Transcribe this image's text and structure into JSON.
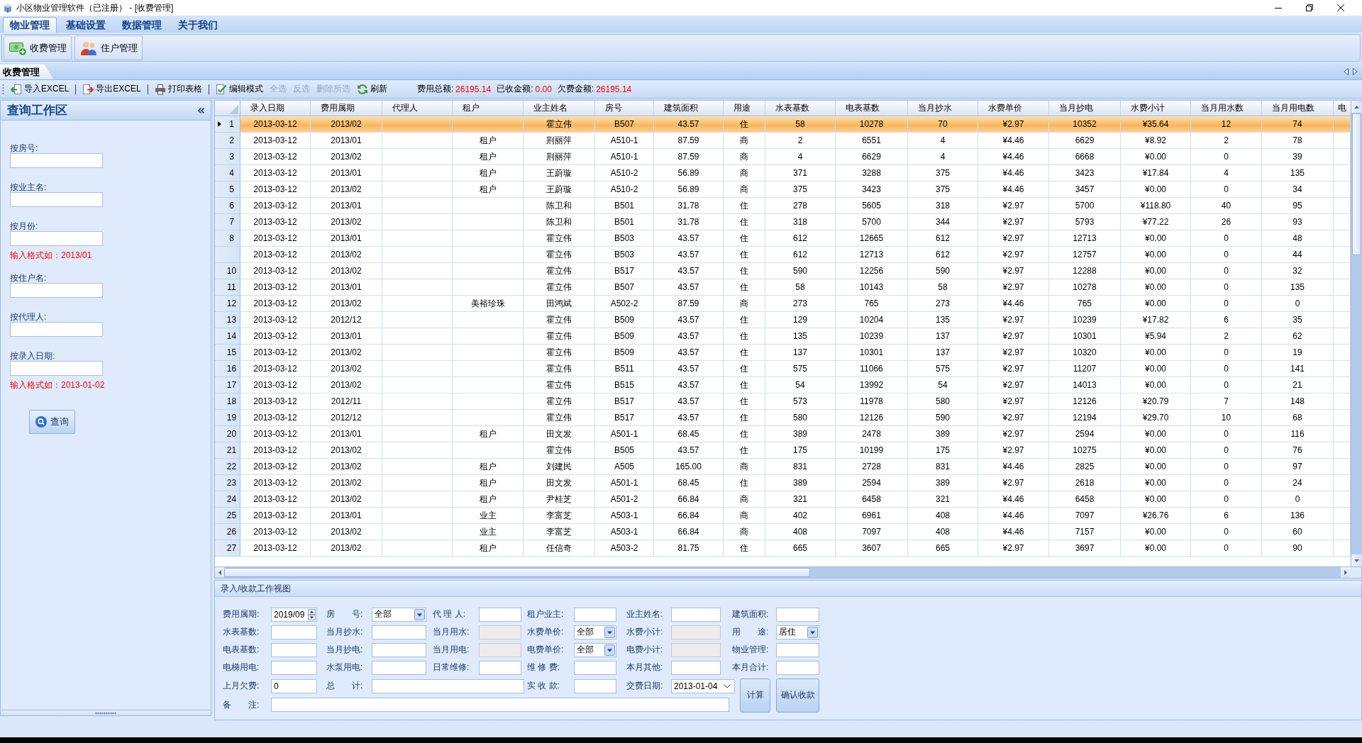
{
  "window": {
    "title": "小区物业管理软件（已注册） - [收费管理]"
  },
  "menu_tabs": [
    {
      "label": "物业管理",
      "selected": true
    },
    {
      "label": "基础设置",
      "selected": false
    },
    {
      "label": "数据管理",
      "selected": false
    },
    {
      "label": "关于我们",
      "selected": false
    }
  ],
  "ribbon": {
    "buttons": [
      "收费管理",
      "住户管理"
    ]
  },
  "document_tabs": [
    {
      "label": "收费管理",
      "selected": true
    }
  ],
  "toolbar": {
    "items": [
      {
        "kind": "button",
        "label": "导入EXCEL",
        "disabled": false
      },
      {
        "kind": "separator"
      },
      {
        "kind": "button",
        "label": "导出EXCEL",
        "disabled": false
      },
      {
        "kind": "separator"
      },
      {
        "kind": "button",
        "label": "打印表格",
        "disabled": false
      },
      {
        "kind": "separator"
      },
      {
        "kind": "button",
        "label": "编辑模式",
        "disabled": false
      },
      {
        "kind": "button",
        "label": "全选",
        "disabled": true
      },
      {
        "kind": "button",
        "label": "反选",
        "disabled": true
      },
      {
        "kind": "button",
        "label": "删除所选",
        "disabled": true
      },
      {
        "kind": "button",
        "label": "刷新",
        "disabled": false
      }
    ],
    "totals": [
      {
        "label": "费用总额:",
        "value": "26195.14"
      },
      {
        "label": "已收金额:",
        "value": "0.00"
      },
      {
        "label": "欠费金额:",
        "value": "26195.14"
      }
    ]
  },
  "search_panel": {
    "title": "查询工作区",
    "fields": [
      {
        "label": "按房号:"
      },
      {
        "label": "按业主名:"
      },
      {
        "label": "按月份:",
        "hint": "输入格式如：2013/01"
      },
      {
        "label": "按住户名:"
      },
      {
        "label": "按代理人:"
      },
      {
        "label": "按录入日期:",
        "hint": "输入格式如：2013-01-02"
      }
    ],
    "button": "查询"
  },
  "grid": {
    "columns": [
      "录入日期",
      "费用属期",
      "代理人",
      "租户",
      "业主姓名",
      "房号",
      "建筑面积",
      "用途",
      "水表基数",
      "电表基数",
      "当月抄水",
      "水费单价",
      "当月抄电",
      "水费小计",
      "当月用水数",
      "当月用电数",
      "电"
    ],
    "rows": [
      {
        "number": "1",
        "selected": true,
        "date": "2013-03-12",
        "period": "2013/02",
        "owner": "霍立伟",
        "room": "B507",
        "area": "43.57",
        "use": "住",
        "water_base": "58",
        "power_base": "10278",
        "water_now": "70",
        "water_price": "¥2.97",
        "power_now": "10352",
        "water_fee": "¥35.64",
        "water_used": "12",
        "power_used": "74"
      },
      {
        "number": "2",
        "selected": false,
        "date": "2013-03-12",
        "period": "2013/01",
        "tenant": "租户",
        "owner": "荆丽萍",
        "room": "A510-1",
        "area": "87.59",
        "use": "商",
        "water_base": "2",
        "power_base": "6551",
        "water_now": "4",
        "water_price": "¥4.46",
        "power_now": "6629",
        "water_fee": "¥8.92",
        "water_used": "2",
        "power_used": "78"
      },
      {
        "number": "3",
        "selected": false,
        "date": "2013-03-12",
        "period": "2013/02",
        "tenant": "租户",
        "owner": "荆丽萍",
        "room": "A510-1",
        "area": "87.59",
        "use": "商",
        "water_base": "4",
        "power_base": "6629",
        "water_now": "4",
        "water_price": "¥4.46",
        "power_now": "6668",
        "water_fee": "¥0.00",
        "water_used": "0",
        "power_used": "39"
      },
      {
        "number": "4",
        "selected": false,
        "date": "2013-03-12",
        "period": "2013/01",
        "tenant": "租户",
        "owner": "王蔚璇",
        "room": "A510-2",
        "area": "56.89",
        "use": "商",
        "water_base": "371",
        "power_base": "3288",
        "water_now": "375",
        "water_price": "¥4.46",
        "power_now": "3423",
        "water_fee": "¥17.84",
        "water_used": "4",
        "power_used": "135"
      },
      {
        "number": "5",
        "selected": false,
        "date": "2013-03-12",
        "period": "2013/02",
        "tenant": "租户",
        "owner": "王蔚璇",
        "room": "A510-2",
        "area": "56.89",
        "use": "商",
        "water_base": "375",
        "power_base": "3423",
        "water_now": "375",
        "water_price": "¥4.46",
        "power_now": "3457",
        "water_fee": "¥0.00",
        "water_used": "0",
        "power_used": "34"
      },
      {
        "number": "6",
        "selected": false,
        "date": "2013-03-12",
        "period": "2013/01",
        "owner": "陈卫和",
        "room": "B501",
        "area": "31.78",
        "use": "住",
        "water_base": "278",
        "power_base": "5605",
        "water_now": "318",
        "water_price": "¥2.97",
        "power_now": "5700",
        "water_fee": "¥118.80",
        "water_used": "40",
        "power_used": "95"
      },
      {
        "number": "7",
        "selected": false,
        "date": "2013-03-12",
        "period": "2013/02",
        "owner": "陈卫和",
        "room": "B501",
        "area": "31.78",
        "use": "住",
        "water_base": "318",
        "power_base": "5700",
        "water_now": "344",
        "water_price": "¥2.97",
        "power_now": "5793",
        "water_fee": "¥77.22",
        "water_used": "26",
        "power_used": "93"
      },
      {
        "number": "8",
        "selected": false,
        "date": "2013-03-12",
        "period": "2013/01",
        "owner": "霍立伟",
        "room": "B503",
        "area": "43.57",
        "use": "住",
        "water_base": "612",
        "power_base": "12665",
        "water_now": "612",
        "water_price": "¥2.97",
        "power_now": "12713",
        "water_fee": "¥0.00",
        "water_used": "0",
        "power_used": "48"
      },
      {
        "selected": false,
        "date": "2013-03-12",
        "period": "2013/02",
        "owner": "霍立伟",
        "room": "B503",
        "area": "43.57",
        "use": "住",
        "water_base": "612",
        "power_base": "12713",
        "water_now": "612",
        "water_price": "¥2.97",
        "power_now": "12757",
        "water_fee": "¥0.00",
        "water_used": "0",
        "power_used": "44"
      },
      {
        "number": "10",
        "selected": false,
        "date": "2013-03-12",
        "period": "2013/02",
        "owner": "霍立伟",
        "room": "B517",
        "area": "43.57",
        "use": "住",
        "water_base": "590",
        "power_base": "12256",
        "water_now": "590",
        "water_price": "¥2.97",
        "power_now": "12288",
        "water_fee": "¥0.00",
        "water_used": "0",
        "power_used": "32"
      },
      {
        "number": "11",
        "selected": false,
        "date": "2013-03-12",
        "period": "2013/01",
        "owner": "霍立伟",
        "room": "B507",
        "area": "43.57",
        "use": "住",
        "water_base": "58",
        "power_base": "10143",
        "water_now": "58",
        "water_price": "¥2.97",
        "power_now": "10278",
        "water_fee": "¥0.00",
        "water_used": "0",
        "power_used": "135"
      },
      {
        "number": "12",
        "selected": false,
        "date": "2013-03-12",
        "period": "2013/02",
        "tenant": "美裕珍珠",
        "owner": "田鸿斌",
        "room": "A502-2",
        "area": "87.59",
        "use": "商",
        "water_base": "273",
        "power_base": "765",
        "water_now": "273",
        "water_price": "¥4.46",
        "power_now": "765",
        "water_fee": "¥0.00",
        "water_used": "0",
        "power_used": "0"
      },
      {
        "number": "13",
        "selected": false,
        "date": "2013-03-12",
        "period": "2012/12",
        "owner": "霍立伟",
        "room": "B509",
        "area": "43.57",
        "use": "住",
        "water_base": "129",
        "power_base": "10204",
        "water_now": "135",
        "water_price": "¥2.97",
        "power_now": "10239",
        "water_fee": "¥17.82",
        "water_used": "6",
        "power_used": "35"
      },
      {
        "number": "14",
        "selected": false,
        "date": "2013-03-12",
        "period": "2013/01",
        "owner": "霍立伟",
        "room": "B509",
        "area": "43.57",
        "use": "住",
        "water_base": "135",
        "power_base": "10239",
        "water_now": "137",
        "water_price": "¥2.97",
        "power_now": "10301",
        "water_fee": "¥5.94",
        "water_used": "2",
        "power_used": "62"
      },
      {
        "number": "15",
        "selected": false,
        "date": "2013-03-12",
        "period": "2013/02",
        "owner": "霍立伟",
        "room": "B509",
        "area": "43.57",
        "use": "住",
        "water_base": "137",
        "power_base": "10301",
        "water_now": "137",
        "water_price": "¥2.97",
        "power_now": "10320",
        "water_fee": "¥0.00",
        "water_used": "0",
        "power_used": "19"
      },
      {
        "number": "16",
        "selected": false,
        "date": "2013-03-12",
        "period": "2013/02",
        "owner": "霍立伟",
        "room": "B511",
        "area": "43.57",
        "use": "住",
        "water_base": "575",
        "power_base": "11066",
        "water_now": "575",
        "water_price": "¥2.97",
        "power_now": "11207",
        "water_fee": "¥0.00",
        "water_used": "0",
        "power_used": "141"
      },
      {
        "number": "17",
        "selected": false,
        "date": "2013-03-12",
        "period": "2013/02",
        "owner": "霍立伟",
        "room": "B515",
        "area": "43.57",
        "use": "住",
        "water_base": "54",
        "power_base": "13992",
        "water_now": "54",
        "water_price": "¥2.97",
        "power_now": "14013",
        "water_fee": "¥0.00",
        "water_used": "0",
        "power_used": "21"
      },
      {
        "number": "18",
        "selected": false,
        "date": "2013-03-12",
        "period": "2012/11",
        "owner": "霍立伟",
        "room": "B517",
        "area": "43.57",
        "use": "住",
        "water_base": "573",
        "power_base": "11978",
        "water_now": "580",
        "water_price": "¥2.97",
        "power_now": "12126",
        "water_fee": "¥20.79",
        "water_used": "7",
        "power_used": "148"
      },
      {
        "number": "19",
        "selected": false,
        "date": "2013-03-12",
        "period": "2012/12",
        "owner": "霍立伟",
        "room": "B517",
        "area": "43.57",
        "use": "住",
        "water_base": "580",
        "power_base": "12126",
        "water_now": "590",
        "water_price": "¥2.97",
        "power_now": "12194",
        "water_fee": "¥29.70",
        "water_used": "10",
        "power_used": "68"
      },
      {
        "number": "20",
        "selected": false,
        "date": "2013-03-12",
        "period": "2013/01",
        "tenant": "租户",
        "owner": "田文发",
        "room": "A501-1",
        "area": "68.45",
        "use": "住",
        "water_base": "389",
        "power_base": "2478",
        "water_now": "389",
        "water_price": "¥2.97",
        "power_now": "2594",
        "water_fee": "¥0.00",
        "water_used": "0",
        "power_used": "116"
      },
      {
        "number": "21",
        "selected": false,
        "date": "2013-03-12",
        "period": "2013/02",
        "owner": "霍立伟",
        "room": "B505",
        "area": "43.57",
        "use": "住",
        "water_base": "175",
        "power_base": "10199",
        "water_now": "175",
        "water_price": "¥2.97",
        "power_now": "10275",
        "water_fee": "¥0.00",
        "water_used": "0",
        "power_used": "76"
      },
      {
        "number": "22",
        "selected": false,
        "date": "2013-03-12",
        "period": "2013/02",
        "tenant": "租户",
        "owner": "刘建民",
        "room": "A505",
        "area": "165.00",
        "use": "商",
        "water_base": "831",
        "power_base": "2728",
        "water_now": "831",
        "water_price": "¥4.46",
        "power_now": "2825",
        "water_fee": "¥0.00",
        "water_used": "0",
        "power_used": "97"
      },
      {
        "number": "23",
        "selected": false,
        "date": "2013-03-12",
        "period": "2013/02",
        "tenant": "租户",
        "owner": "田文发",
        "room": "A501-1",
        "area": "68.45",
        "use": "住",
        "water_base": "389",
        "power_base": "2594",
        "water_now": "389",
        "water_price": "¥2.97",
        "power_now": "2618",
        "water_fee": "¥0.00",
        "water_used": "0",
        "power_used": "24"
      },
      {
        "number": "24",
        "selected": false,
        "date": "2013-03-12",
        "period": "2013/02",
        "tenant": "租户",
        "owner": "尹桂芝",
        "room": "A501-2",
        "area": "66.84",
        "use": "商",
        "water_base": "321",
        "power_base": "6458",
        "water_now": "321",
        "water_price": "¥4.46",
        "power_now": "6458",
        "water_fee": "¥0.00",
        "water_used": "0",
        "power_used": "0"
      },
      {
        "number": "25",
        "selected": false,
        "date": "2013-03-12",
        "period": "2013/01",
        "tenant": "业主",
        "owner": "李富芝",
        "room": "A503-1",
        "area": "66.84",
        "use": "商",
        "water_base": "402",
        "power_base": "6961",
        "water_now": "408",
        "water_price": "¥4.46",
        "power_now": "7097",
        "water_fee": "¥26.76",
        "water_used": "6",
        "power_used": "136"
      },
      {
        "number": "26",
        "selected": false,
        "date": "2013-03-12",
        "period": "2013/02",
        "tenant": "业主",
        "owner": "李富芝",
        "room": "A503-1",
        "area": "66.84",
        "use": "商",
        "water_base": "408",
        "power_base": "7097",
        "water_now": "408",
        "water_price": "¥4.46",
        "power_now": "7157",
        "water_fee": "¥0.00",
        "water_used": "0",
        "power_used": "60"
      },
      {
        "number": "27",
        "selected": false,
        "date": "2013-03-12",
        "period": "2013/02",
        "tenant": "租户",
        "owner": "任信奇",
        "room": "A503-2",
        "area": "81.75",
        "use": "住",
        "water_base": "665",
        "power_base": "3607",
        "water_now": "665",
        "water_price": "¥2.97",
        "power_now": "3697",
        "water_fee": "¥0.00",
        "water_used": "0",
        "power_used": "90"
      }
    ]
  },
  "entry_form": {
    "title": "录入/收款工作视图",
    "rows": [
      [
        {
          "label": "费用属期:",
          "kind": "spin",
          "value": "2019/09",
          "disabled": false
        },
        {
          "label": "房　　号:",
          "kind": "select",
          "value": "全部",
          "disabled": false
        },
        {
          "label": "代 理 人:",
          "kind": "text",
          "disabled": false
        },
        {
          "label": "租户业主:",
          "kind": "text",
          "disabled": false
        },
        {
          "label": "业主姓名:",
          "kind": "text",
          "disabled": false
        },
        {
          "label": "建筑面积:",
          "kind": "text",
          "disabled": false
        }
      ],
      [
        {
          "label": "水表基数:",
          "kind": "text",
          "disabled": false
        },
        {
          "label": "当月抄水:",
          "kind": "text",
          "disabled": false
        },
        {
          "label": "当月用水:",
          "kind": "text",
          "disabled": true
        },
        {
          "label": "水费单价:",
          "kind": "select",
          "value": "全部",
          "disabled": false
        },
        {
          "label": "水费小计:",
          "kind": "text",
          "disabled": true
        },
        {
          "label": "用　　途:",
          "kind": "select",
          "value": "居住",
          "disabled": false
        }
      ],
      [
        {
          "label": "电表基数:",
          "kind": "text",
          "disabled": false
        },
        {
          "label": "当月抄电:",
          "kind": "text",
          "disabled": false
        },
        {
          "label": "当月用电:",
          "kind": "text",
          "disabled": true
        },
        {
          "label": "电费单价:",
          "kind": "select",
          "value": "全部",
          "disabled": false
        },
        {
          "label": "电费小计:",
          "kind": "text",
          "disabled": true
        },
        {
          "label": "物业管理:",
          "kind": "text",
          "disabled": false
        }
      ],
      [
        {
          "label": "电梯用电:",
          "kind": "text",
          "disabled": false
        },
        {
          "label": "水泵用电:",
          "kind": "text",
          "disabled": false
        },
        {
          "label": "日常维修:",
          "kind": "text",
          "disabled": false
        },
        {
          "label": "维 修 费:",
          "kind": "text",
          "disabled": false
        },
        {
          "label": "本月其他:",
          "kind": "text",
          "disabled": false
        },
        {
          "label": "本月合计:",
          "kind": "text",
          "disabled": false
        }
      ],
      [
        {
          "label": "上月欠费:",
          "kind": "text",
          "value": "0",
          "disabled": false
        },
        {
          "label": "总　　计:",
          "kind": "text",
          "disabled": false
        },
        "",
        {
          "label": "实 收 款:",
          "kind": "text",
          "disabled": false
        },
        {
          "label": "交费日期:",
          "kind": "date",
          "value": "2013-01-04",
          "disabled": false
        }
      ],
      [
        {
          "label": "备　　注:",
          "kind": "text",
          "disabled": false
        },
        "",
        "",
        "",
        ""
      ]
    ],
    "buttons": [
      "计算",
      "确认收款"
    ]
  }
}
